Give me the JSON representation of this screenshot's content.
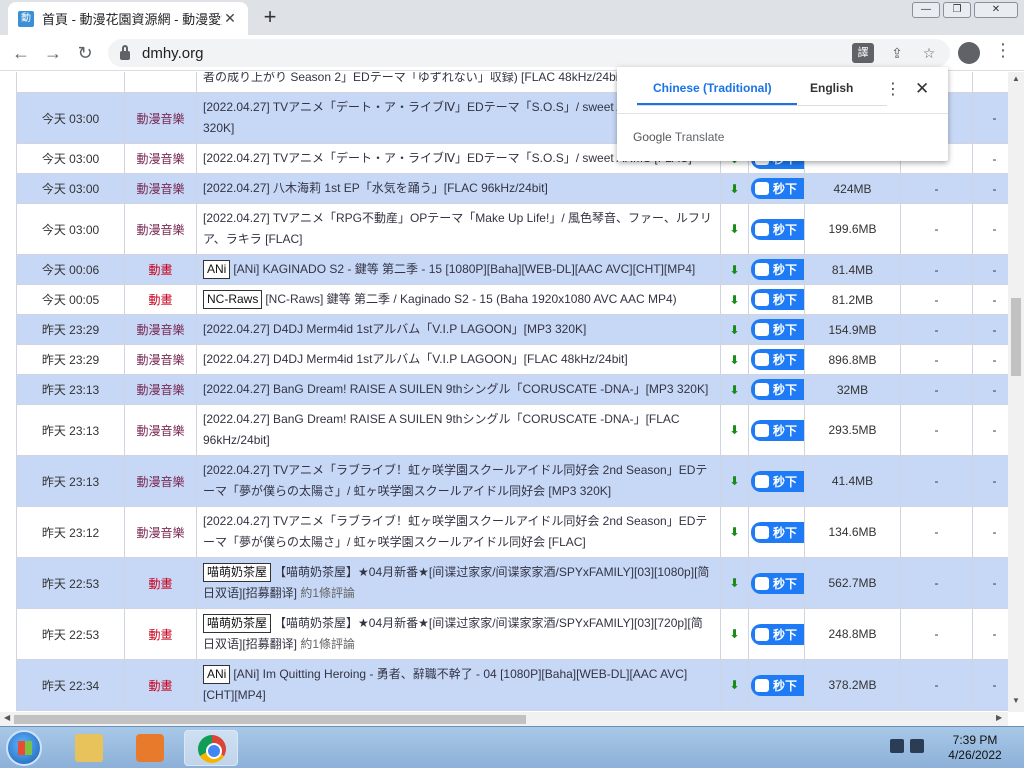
{
  "window": {
    "tab_title": "首頁 - 動漫花園資源網 - 動漫愛好",
    "tab_close": "✕",
    "new_tab": "+",
    "minimize": "—",
    "maximize": "❐",
    "close": "✕"
  },
  "toolbar": {
    "back": "←",
    "forward": "→",
    "reload": "↻",
    "url": "dmhy.org",
    "translate_icon_label": "譯",
    "share": "⇪",
    "bookmark": "☆",
    "menu": "⋮"
  },
  "table": {
    "top_partial": "者の成り上がり Season 2」EDテーマ「ゆずれない」収録) [FLAC 48kHz/24bit]",
    "rows": [
      {
        "style": "alt",
        "time": "今天 03:00",
        "category": "動漫音樂",
        "cat_color": "music",
        "tag": "",
        "title": "[2022.04.27] TVアニメ「デート・ア・ライブⅣ」EDテーマ「S.O.S」/ sweet ARMS [MP3 320K]",
        "comments": "",
        "magnet": "秒下",
        "size": "",
        "seeds": "-",
        "edge": "-"
      },
      {
        "style": "plain",
        "time": "今天 03:00",
        "category": "動漫音樂",
        "cat_color": "music",
        "tag": "",
        "title": "[2022.04.27] TVアニメ「デート・ア・ライブⅣ」EDテーマ「S.O.S」/ sweet ARMS [FLAC]",
        "comments": "",
        "magnet": "秒下",
        "size": "",
        "seeds": "-",
        "edge": "-"
      },
      {
        "style": "alt",
        "time": "今天 03:00",
        "category": "動漫音樂",
        "cat_color": "music",
        "tag": "",
        "title": "[2022.04.27] 八木海莉 1st EP「水気を踊う」[FLAC 96kHz/24bit]",
        "comments": "",
        "magnet": "秒下",
        "size": "424MB",
        "seeds": "-",
        "edge": "-"
      },
      {
        "style": "plain",
        "time": "今天 03:00",
        "category": "動漫音樂",
        "cat_color": "music",
        "tag": "",
        "title": "[2022.04.27] TVアニメ「RPG不動産」OPテーマ「Make Up Life!」/ 風色琴音、ファー、ルフリア、ラキラ [FLAC]",
        "comments": "",
        "magnet": "秒下",
        "size": "199.6MB",
        "seeds": "-",
        "edge": "-"
      },
      {
        "style": "alt",
        "time": "今天 00:06",
        "category": "動畫",
        "cat_color": "anime",
        "tag": "ANi",
        "title": "[ANi] KAGINADO S2 - 鍵等 第二季 - 15 [1080P][Baha][WEB-DL][AAC AVC][CHT][MP4]",
        "comments": "",
        "magnet": "秒下",
        "size": "81.4MB",
        "seeds": "-",
        "edge": "-"
      },
      {
        "style": "plain",
        "time": "今天 00:05",
        "category": "動畫",
        "cat_color": "anime",
        "tag": "NC-Raws",
        "title": "[NC-Raws] 鍵等 第二季 / Kaginado S2 - 15 (Baha 1920x1080 AVC AAC MP4)",
        "comments": "",
        "magnet": "秒下",
        "size": "81.2MB",
        "seeds": "-",
        "edge": "-"
      },
      {
        "style": "alt",
        "time": "昨天 23:29",
        "category": "動漫音樂",
        "cat_color": "music",
        "tag": "",
        "title": "[2022.04.27] D4DJ Merm4id 1stアルバム「V.I.P LAGOON」[MP3 320K]",
        "comments": "",
        "magnet": "秒下",
        "size": "154.9MB",
        "seeds": "-",
        "edge": "-"
      },
      {
        "style": "plain",
        "time": "昨天 23:29",
        "category": "動漫音樂",
        "cat_color": "music",
        "tag": "",
        "title": "[2022.04.27] D4DJ Merm4id 1stアルバム「V.I.P LAGOON」[FLAC 48kHz/24bit]",
        "comments": "",
        "magnet": "秒下",
        "size": "896.8MB",
        "seeds": "-",
        "edge": "-"
      },
      {
        "style": "alt",
        "time": "昨天 23:13",
        "category": "動漫音樂",
        "cat_color": "music",
        "tag": "",
        "title": "[2022.04.27] BanG Dream! RAISE A SUILEN 9thシングル「CORUSCATE -DNA-」[MP3 320K]",
        "comments": "",
        "magnet": "秒下",
        "size": "32MB",
        "seeds": "-",
        "edge": "-"
      },
      {
        "style": "plain",
        "time": "昨天 23:13",
        "category": "動漫音樂",
        "cat_color": "music",
        "tag": "",
        "title": "[2022.04.27] BanG Dream! RAISE A SUILEN 9thシングル「CORUSCATE -DNA-」[FLAC 96kHz/24bit]",
        "comments": "",
        "magnet": "秒下",
        "size": "293.5MB",
        "seeds": "-",
        "edge": "-"
      },
      {
        "style": "alt",
        "time": "昨天 23:13",
        "category": "動漫音樂",
        "cat_color": "music",
        "tag": "",
        "title": "[2022.04.27] TVアニメ「ラブライブ！虹ヶ咲学園スクールアイドル同好会 2nd Season」EDテーマ「夢が僕らの太陽さ」/ 虹ヶ咲学園スクールアイドル同好会 [MP3 320K]",
        "comments": "",
        "magnet": "秒下",
        "size": "41.4MB",
        "seeds": "-",
        "edge": "-"
      },
      {
        "style": "plain",
        "time": "昨天 23:12",
        "category": "動漫音樂",
        "cat_color": "music",
        "tag": "",
        "title": "[2022.04.27] TVアニメ「ラブライブ！虹ヶ咲学園スクールアイドル同好会 2nd Season」EDテーマ「夢が僕らの太陽さ」/ 虹ヶ咲学園スクールアイドル同好会 [FLAC]",
        "comments": "",
        "magnet": "秒下",
        "size": "134.6MB",
        "seeds": "-",
        "edge": "-"
      },
      {
        "style": "alt",
        "time": "昨天 22:53",
        "category": "動畫",
        "cat_color": "anime",
        "tag": "喵萌奶茶屋",
        "title": "【喵萌奶茶屋】★04月新番★[间谍过家家/间谍家家酒/SPYxFAMILY][03][1080p][简日双语][招募翻译]",
        "comments": "約1條評論",
        "magnet": "秒下",
        "size": "562.7MB",
        "seeds": "-",
        "edge": "-"
      },
      {
        "style": "plain",
        "time": "昨天 22:53",
        "category": "動畫",
        "cat_color": "anime",
        "tag": "喵萌奶茶屋",
        "title": "【喵萌奶茶屋】★04月新番★[间谍过家家/间谍家家酒/SPYxFAMILY][03][720p][简日双语][招募翻译]",
        "comments": "約1條評論",
        "magnet": "秒下",
        "size": "248.8MB",
        "seeds": "-",
        "edge": "-"
      },
      {
        "style": "alt",
        "time": "昨天 22:34",
        "category": "動畫",
        "cat_color": "anime",
        "tag": "ANi",
        "title": "[ANi] Im Quitting Heroing - 勇者、辭職不幹了 - 04 [1080P][Baha][WEB-DL][AAC AVC][CHT][MP4]",
        "comments": "",
        "magnet": "秒下",
        "size": "378.2MB",
        "seeds": "-",
        "edge": "-"
      }
    ]
  },
  "translate_popup": {
    "tab_active": "Chinese (Traditional)",
    "tab_other": "English",
    "more": "⋮",
    "close": "✕",
    "brand_google": "Google",
    "brand_translate": "Translate"
  },
  "taskbar": {
    "time": "7:39 PM",
    "date": "4/26/2022"
  },
  "colors": {
    "row_alt": "#c7d8f6",
    "magnet_button": "#1e7bf5",
    "category_music": "#7a2a55",
    "category_anime": "#c8001e",
    "translate_accent": "#1a73e8"
  }
}
